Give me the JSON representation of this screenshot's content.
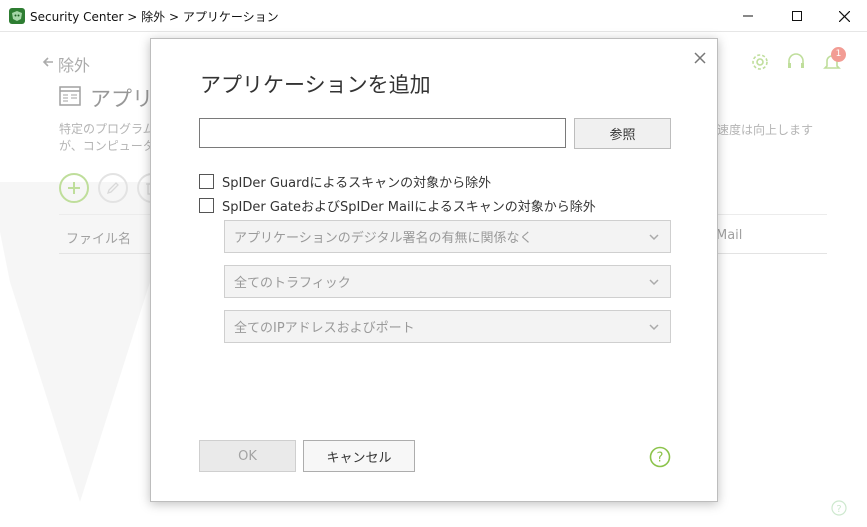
{
  "window": {
    "title": "Security Center > 除外 > アプリケーション"
  },
  "background": {
    "back_label": "除外",
    "page_title": "アプリ",
    "desc_line1": "特定のプログラム",
    "desc_line2": "が、コンピューター",
    "desc_right": "速度は向上します",
    "columns": {
      "file": "ファイル名",
      "mail": "Mail"
    },
    "notification_count": "1"
  },
  "dialog": {
    "title": "アプリケーションを追加",
    "path_value": "",
    "browse_label": "参照",
    "checkbox_guard": {
      "label": "SpIDer Guardによるスキャンの対象から除外",
      "checked": false
    },
    "checkbox_gate_mail": {
      "label": "SpIDer GateおよびSpIDer Mailによるスキャンの対象から除外",
      "checked": false
    },
    "selects": [
      "アプリケーションのデジタル署名の有無に関係なく",
      "全てのトラフィック",
      "全てのIPアドレスおよびポート"
    ],
    "ok_label": "OK",
    "cancel_label": "キャンセル"
  },
  "colors": {
    "accent_green": "#8bc34a",
    "badge_red": "#e74c3c"
  },
  "icons": [
    "app-logo-icon",
    "minimize-icon",
    "maximize-icon",
    "close-icon",
    "back-arrow-icon",
    "settings-gear-icon",
    "support-headset-icon",
    "notification-bell-icon",
    "help-icon",
    "chevron-down-icon"
  ]
}
